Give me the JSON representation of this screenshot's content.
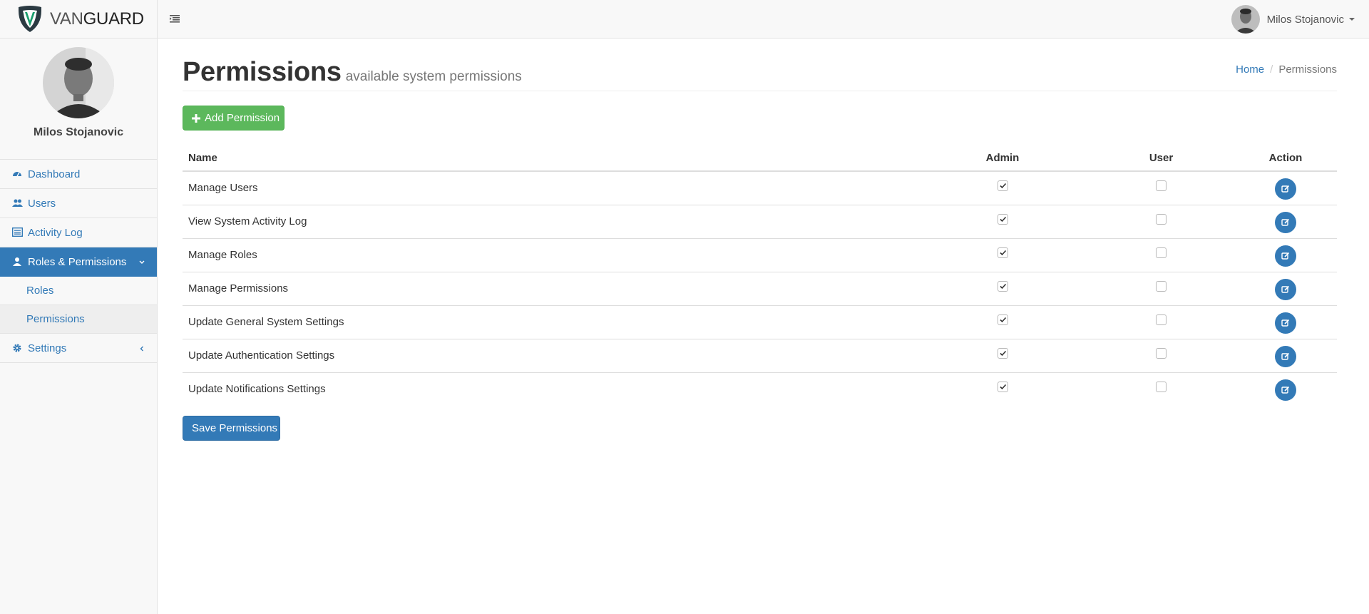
{
  "brand": {
    "name_a": "VAN",
    "name_b": "GUARD"
  },
  "header": {
    "user_name": "Milos Stojanovic"
  },
  "sidebar": {
    "profile_name": "Milos Stojanovic",
    "items": [
      {
        "label": "Dashboard",
        "icon": "dashboard-icon"
      },
      {
        "label": "Users",
        "icon": "users-icon"
      },
      {
        "label": "Activity Log",
        "icon": "activity-log-icon"
      },
      {
        "label": "Roles & Permissions",
        "icon": "user-icon",
        "active": true
      },
      {
        "label": "Settings",
        "icon": "gear-icon"
      }
    ],
    "sub_items": [
      {
        "label": "Roles"
      },
      {
        "label": "Permissions",
        "current": true
      }
    ]
  },
  "page": {
    "title": "Permissions",
    "subtitle": "available system permissions",
    "breadcrumb": {
      "home": "Home",
      "current": "Permissions"
    },
    "add_button": "Add Permission",
    "save_button": "Save Permissions"
  },
  "table": {
    "columns": [
      "Name",
      "Admin",
      "User",
      "Action"
    ],
    "rows": [
      {
        "name": "Manage Users",
        "admin": true,
        "user": false
      },
      {
        "name": "View System Activity Log",
        "admin": true,
        "user": false
      },
      {
        "name": "Manage Roles",
        "admin": true,
        "user": false
      },
      {
        "name": "Manage Permissions",
        "admin": true,
        "user": false
      },
      {
        "name": "Update General System Settings",
        "admin": true,
        "user": false
      },
      {
        "name": "Update Authentication Settings",
        "admin": true,
        "user": false
      },
      {
        "name": "Update Notifications Settings",
        "admin": true,
        "user": false
      }
    ]
  },
  "colors": {
    "primary": "#337ab7",
    "success": "#5cb85c",
    "logo_green": "#1a9e6e"
  }
}
